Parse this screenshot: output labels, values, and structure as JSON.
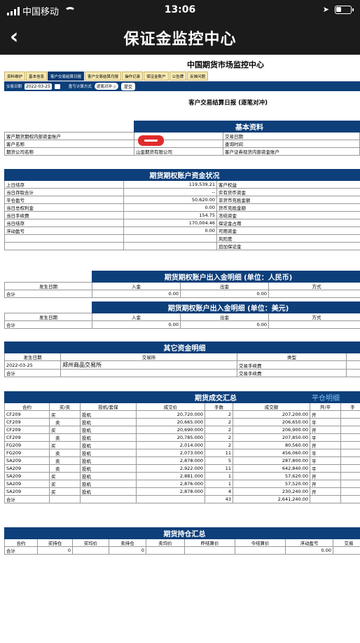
{
  "status": {
    "carrier": "中国移动",
    "time": "13:06"
  },
  "nav": {
    "back": "‹",
    "title": "保证金监控中心"
  },
  "center_title": "中国期货市场监控中心",
  "tabs": [
    "资料维护",
    "基本信息",
    "客户交易结算日报",
    "客户交易结算月报",
    "操作记录",
    "保证金账户",
    "公告牌",
    "反映问题"
  ],
  "filter": {
    "date_label": "交易日期",
    "date_value": "2022-03-25",
    "method_label": "盈亏计算方式",
    "method_value": "逐笔对冲 ◇",
    "query": "提交"
  },
  "report_title": "客户交易结算日报 (逐笔对冲)",
  "basic": {
    "title": "基本资料",
    "rows": [
      [
        "客户期货期权内部资金账户",
        "",
        "交易日期",
        "2"
      ],
      [
        "客户名称",
        "",
        "查询时间",
        "2"
      ],
      [
        "期货公司名称",
        "山金期货有限公司",
        "客户证券现货内部资金账户",
        ""
      ]
    ]
  },
  "funds": {
    "title": "期货期权账户资金状况",
    "rows": [
      [
        "上日结存",
        "119,539.21",
        "客户权益"
      ],
      [
        "当日存取合计",
        "--",
        "实有货币资金"
      ],
      [
        "平仓盈亏",
        "50,620.00",
        "非货币充抵金额"
      ],
      [
        "当日总权利金",
        "0.00",
        "货币充抵金额"
      ],
      [
        "当日手续费",
        "154.75",
        "冻结资金"
      ],
      [
        "当日结存",
        "170,004.46",
        "保证金占用"
      ],
      [
        "浮动盈亏",
        "0.00",
        "可用资金"
      ],
      [
        "",
        "",
        "风险度"
      ],
      [
        "",
        "",
        "追加保证金"
      ]
    ]
  },
  "cny": {
    "title": "期货期权账户出入金明细 (单位：人民币)",
    "headers": [
      "发生日期",
      "入金",
      "出金",
      "方式"
    ],
    "total": [
      "合计",
      "0.00",
      "0.00",
      ""
    ]
  },
  "usd": {
    "title": "期货期权账户出入金明细 (单位：美元)",
    "headers": [
      "发生日期",
      "入金",
      "出金",
      "方式"
    ],
    "total": [
      "合计",
      "0.00",
      "0.00",
      ""
    ]
  },
  "other": {
    "title": "其它资金明细",
    "headers": [
      "发生日期",
      "交易所",
      "类型"
    ],
    "rows": [
      [
        "2022-03-25",
        "郑州商品交易所",
        "交易手续费"
      ],
      [
        "合计",
        "",
        "交易手续费"
      ]
    ]
  },
  "trades": {
    "title": "期货成交汇总",
    "side": "平仓明细",
    "headers": [
      "合约",
      "买/卖",
      "投机/套保",
      "成交价",
      "手数",
      "成交额",
      "开/平",
      "手"
    ],
    "rows": [
      [
        "CF209",
        "买",
        "投机",
        "20,720.000",
        "2",
        "207,200.00",
        "开"
      ],
      [
        "CF209",
        "卖",
        "投机",
        "20,665.000",
        "2",
        "206,650.00",
        "平"
      ],
      [
        "CF209",
        "买",
        "投机",
        "20,690.000",
        "2",
        "206,900.00",
        "开"
      ],
      [
        "CF209",
        "卖",
        "投机",
        "20,785.000",
        "2",
        "207,850.00",
        "平"
      ],
      [
        "FG209",
        "买",
        "投机",
        "2,014.000",
        "2",
        "80,560.00",
        "开"
      ],
      [
        "FG209",
        "卖",
        "投机",
        "2,073.000",
        "11",
        "456,060.00",
        "平"
      ],
      [
        "SA209",
        "卖",
        "投机",
        "2,878.000",
        "5",
        "287,800.00",
        "平"
      ],
      [
        "SA209",
        "卖",
        "投机",
        "2,922.000",
        "11",
        "642,840.00",
        "平"
      ],
      [
        "SA209",
        "买",
        "投机",
        "2,881.000",
        "1",
        "57,620.00",
        "开"
      ],
      [
        "SA209",
        "买",
        "投机",
        "2,876.000",
        "1",
        "57,520.00",
        "开"
      ],
      [
        "SA209",
        "买",
        "投机",
        "2,878.000",
        "4",
        "230,240.00",
        "开"
      ]
    ],
    "total": [
      "合计",
      "",
      "",
      "",
      "43",
      "2,641,240.00",
      ""
    ]
  },
  "holds": {
    "title": "期货持仓汇总",
    "headers": [
      "合约",
      "买持仓",
      "买均价",
      "卖持仓",
      "卖均价",
      "昨结算价",
      "今结算价",
      "浮动盈亏",
      "交易"
    ],
    "total": [
      "合计",
      "0",
      "",
      "0",
      "",
      "",
      "",
      "0.00",
      ""
    ]
  }
}
